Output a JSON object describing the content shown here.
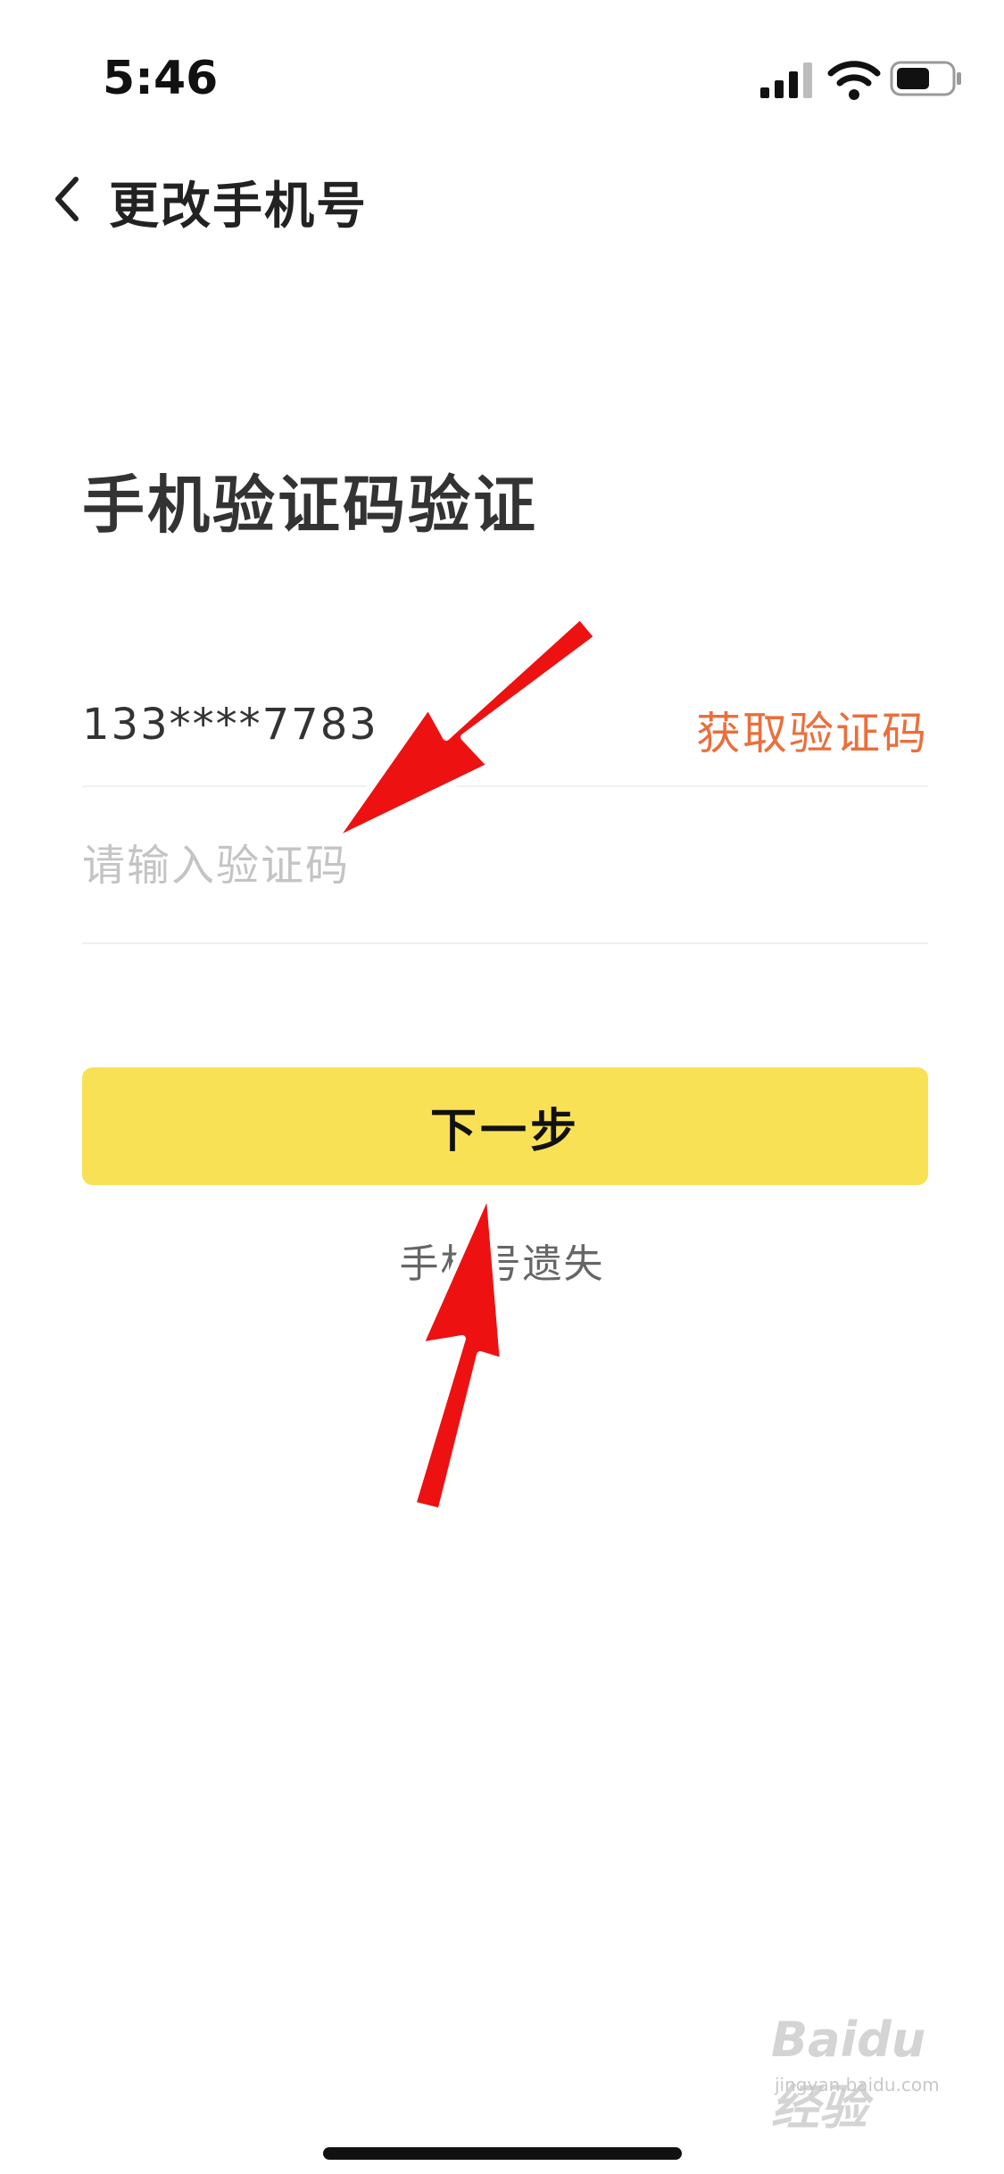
{
  "status_bar": {
    "time": "5:46",
    "icons": [
      "signal-icon",
      "wifi-icon",
      "battery-icon"
    ]
  },
  "nav": {
    "back_icon": "chevron-left-icon",
    "title": "更改手机号"
  },
  "page_title": "手机验证码验证",
  "phone": {
    "number": "133****7783",
    "get_code_label": "获取验证码"
  },
  "code_input": {
    "value": "",
    "placeholder": "请输入验证码"
  },
  "next_button": {
    "label": "下一步"
  },
  "lost_phone_link": "手机号遗失",
  "watermark": {
    "text": "Baidu经验",
    "url": "jingyan.baidu.com"
  },
  "colors": {
    "accent_yellow": "#f9e156",
    "link_orange": "#ea6f3c",
    "annotation_red": "#ee1111"
  }
}
